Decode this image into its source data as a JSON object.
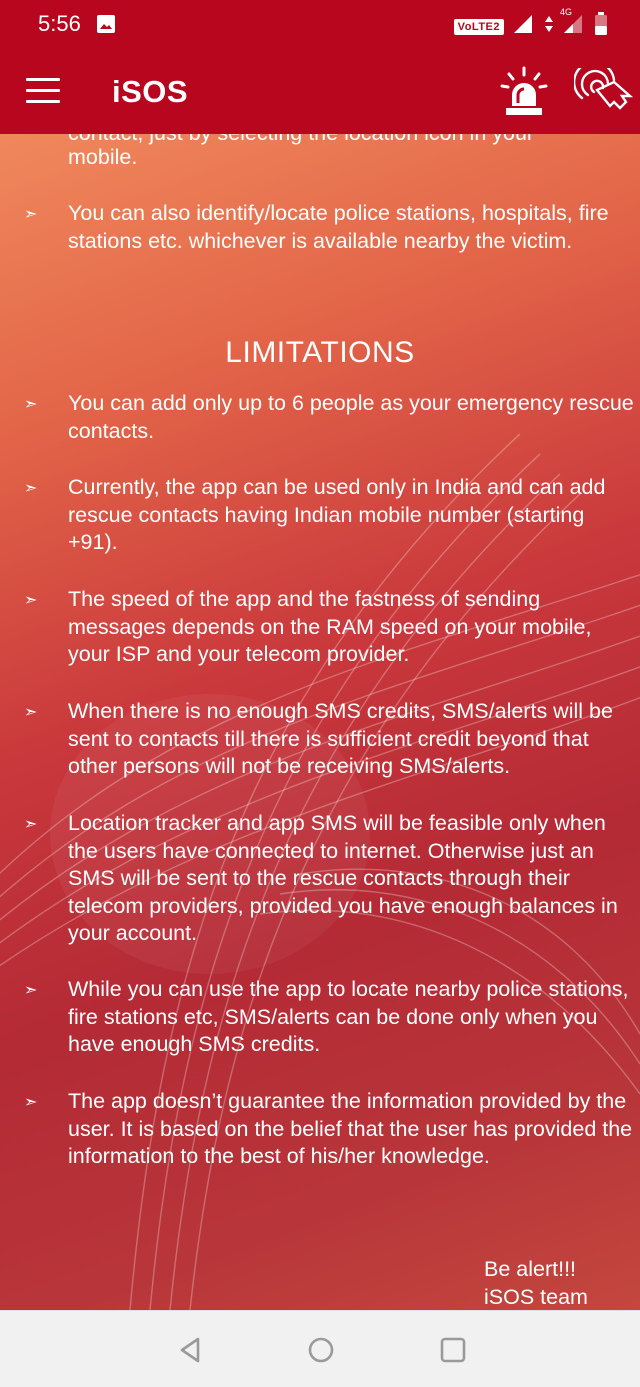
{
  "status": {
    "time": "5:56",
    "network": "VoLTE2",
    "signal_label": "4G",
    "roaming_mark": "R",
    "icons": [
      "gallery-icon",
      "volte-icon",
      "signal-icon",
      "battery-icon"
    ]
  },
  "header": {
    "title": "iSOS",
    "icons": [
      "menu-icon",
      "siren-icon",
      "tap-icon"
    ]
  },
  "content": {
    "partial_line": "contact, just by selecting the location icon in your",
    "intro_items": [
      {
        "text": "mobile."
      },
      {
        "text": "You can also identify/locate police stations, hospitals, fire stations etc. whichever is available nearby the victim."
      }
    ],
    "heading": "LIMITATIONS",
    "limitations": [
      {
        "text": "You can add only up to 6 people as your emergency rescue contacts."
      },
      {
        "text": "Currently, the app can be used only in India and can add rescue contacts having Indian mobile number (starting +91)."
      },
      {
        "text": "The speed of the app and the fastness of sending messages depends on the RAM speed on your mobile, your ISP and your telecom provider."
      },
      {
        "text": "When there is no enough SMS credits, SMS/alerts will be sent to contacts till there is sufficient credit beyond that other persons will not be receiving SMS/alerts."
      },
      {
        "text": "Location tracker and app SMS will be feasible only when the users have connected to internet. Otherwise just an SMS will be sent to the rescue contacts through their telecom providers, provided you have enough balances in your account."
      },
      {
        "text": "While you can use the app to locate nearby police stations, fire stations etc, SMS/alerts can be done only when you have enough SMS credits."
      },
      {
        "text": "The app doesn’t guarantee the information provided by the user. It is based on the belief that the user has provided the information to the best of his/her knowledge."
      }
    ],
    "signoff_line1": "Be alert!!!",
    "signoff_line2": "iSOS team",
    "bullet_glyph": "➣"
  },
  "nav": {
    "icons": [
      "back-icon",
      "home-icon",
      "recents-icon"
    ]
  },
  "colors": {
    "app_bar": "#b8061e",
    "nav_bar": "#f1f1f1",
    "text": "#ffffff"
  }
}
